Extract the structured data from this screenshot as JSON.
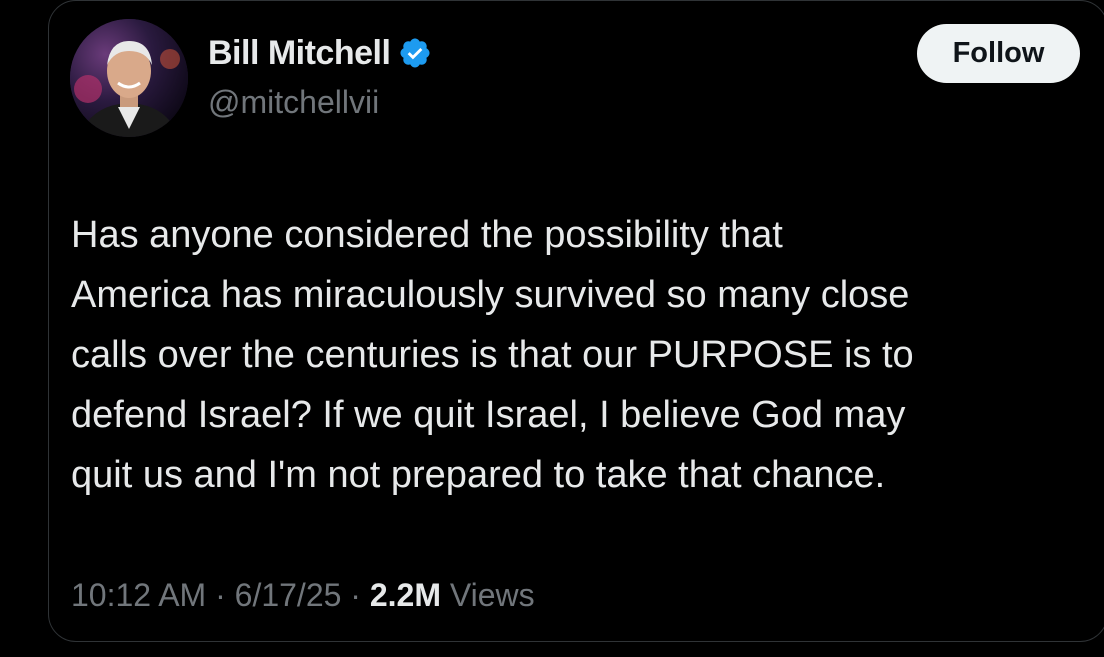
{
  "author": {
    "name": "Bill Mitchell",
    "handle": "@mitchellvii",
    "avatar_icon": "profile-photo",
    "verified_icon": "verified-badge-icon",
    "verified_color": "#1d9bf0"
  },
  "follow_button": {
    "label": "Follow"
  },
  "tweet": {
    "text": "Has anyone considered the possibility that\nAmerica has miraculously survived so many close\ncalls over the centuries is that our PURPOSE is to\ndefend Israel?  If we quit Israel, I believe God may\nquit us and I'm not prepared to take that chance."
  },
  "meta": {
    "time": "10:12 AM",
    "separator": " · ",
    "date": "6/17/25",
    "views_count": "2.2M",
    "views_label": "Views"
  },
  "colors": {
    "background": "#000000",
    "text": "#e7e9ea",
    "muted": "#71767b",
    "button_bg": "#eff3f4"
  }
}
